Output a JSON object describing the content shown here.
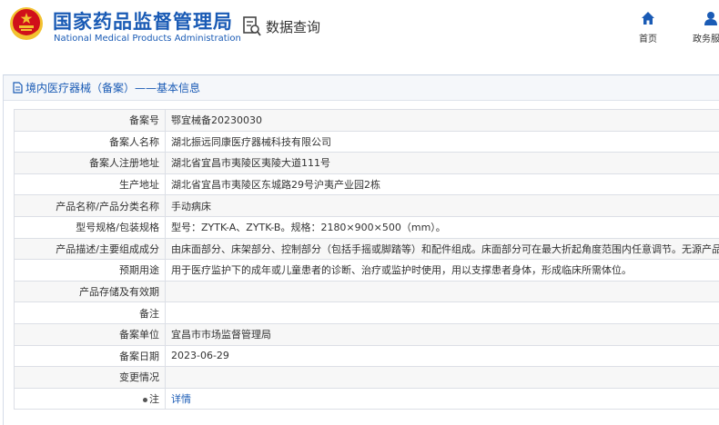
{
  "header": {
    "org_name_cn": "国家药品监督管理局",
    "org_name_en": "National Medical Products Administration",
    "query_label": "数据查询",
    "nav": [
      {
        "label": "首页",
        "icon": "home-icon"
      },
      {
        "label": "政务服务",
        "icon": "user-icon"
      }
    ]
  },
  "panel": {
    "title": "境内医疗器械（备案）——基本信息"
  },
  "rows": [
    {
      "label": "备案号",
      "value": "鄂宜械备20230030"
    },
    {
      "label": "备案人名称",
      "value": "湖北振远同康医疗器械科技有限公司"
    },
    {
      "label": "备案人注册地址",
      "value": "湖北省宜昌市夷陵区夷陵大道111号"
    },
    {
      "label": "生产地址",
      "value": "湖北省宜昌市夷陵区东城路29号沪夷产业园2栋"
    },
    {
      "label": "产品名称/产品分类名称",
      "value": "手动病床"
    },
    {
      "label": "型号规格/包装规格",
      "value": "型号：ZYTK-A、ZYTK-B。规格：2180×900×500（mm）。"
    },
    {
      "label": "产品描述/主要组成成分",
      "value": "由床面部分、床架部分、控制部分（包括手摇或脚踏等）和配件组成。床面部分可在最大折起角度范围内任意调节。无源产品。"
    },
    {
      "label": "预期用途",
      "value": "用于医疗监护下的成年或儿童患者的诊断、治疗或监护时使用，用以支撑患者身体，形成临床所需体位。"
    },
    {
      "label": "产品存储及有效期",
      "value": ""
    },
    {
      "label": "备注",
      "value": ""
    },
    {
      "label": "备案单位",
      "value": "宜昌市市场监督管理局"
    },
    {
      "label": "备案日期",
      "value": "2023-06-29"
    },
    {
      "label": "变更情况",
      "value": ""
    },
    {
      "label": "注",
      "value": "详情"
    }
  ],
  "colors": {
    "brand": "#1a5bb5",
    "emblem_red": "#d0101a",
    "emblem_gold": "#f2c230"
  }
}
